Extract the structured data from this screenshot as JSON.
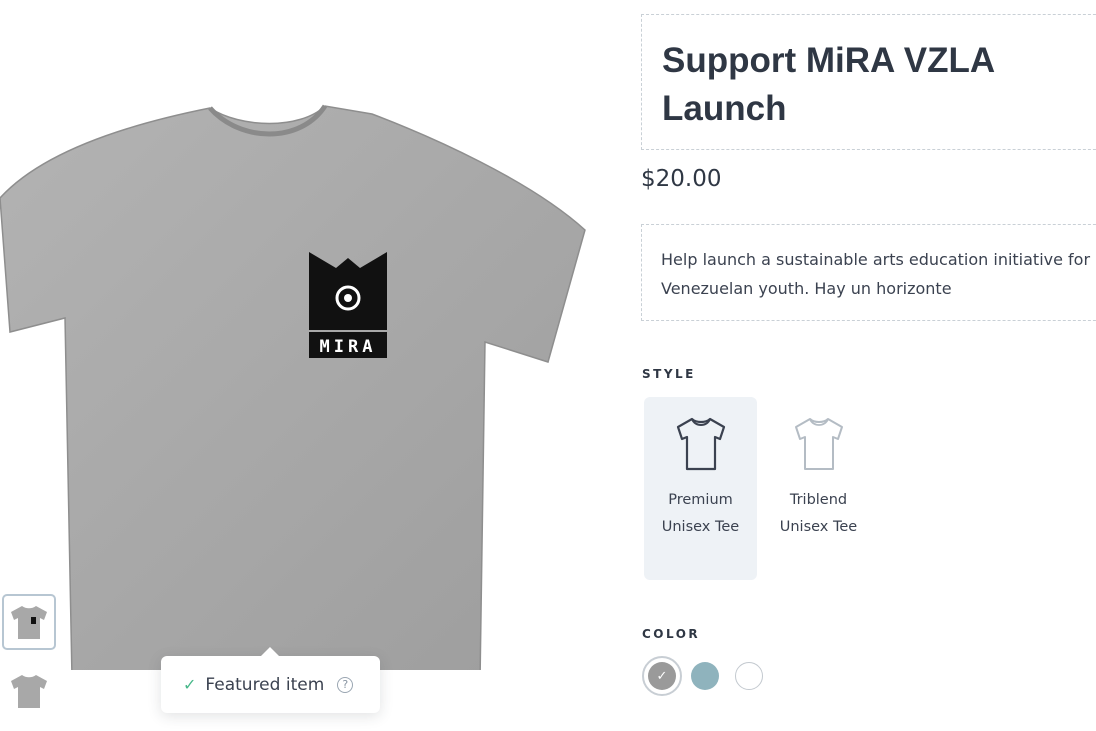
{
  "product": {
    "title": "Support MiRA VZLA Launch",
    "price": "$20.00",
    "description": "Help launch a sustainable arts education initiative for Venezuelan youth. Hay un horizonte",
    "print_text": "MIRA"
  },
  "featured": {
    "label": "Featured item",
    "help_glyph": "?",
    "check_glyph": "✓"
  },
  "style": {
    "label": "STYLE",
    "options": [
      {
        "name": "Premium Unisex Tee",
        "selected": true
      },
      {
        "name": "Triblend Unisex Tee",
        "selected": false
      }
    ]
  },
  "color": {
    "label": "COLOR",
    "swatches": [
      {
        "color": "#9a9a9a",
        "selected": true
      },
      {
        "color": "#8fb3bd",
        "selected": false
      },
      {
        "color": "#ffffff",
        "selected": false
      }
    ]
  },
  "colors": {
    "shirt": "#a9a9a9",
    "text": "#2f3744",
    "accent_check": "#48b88a",
    "selected_style_bg": "#eef2f6"
  }
}
